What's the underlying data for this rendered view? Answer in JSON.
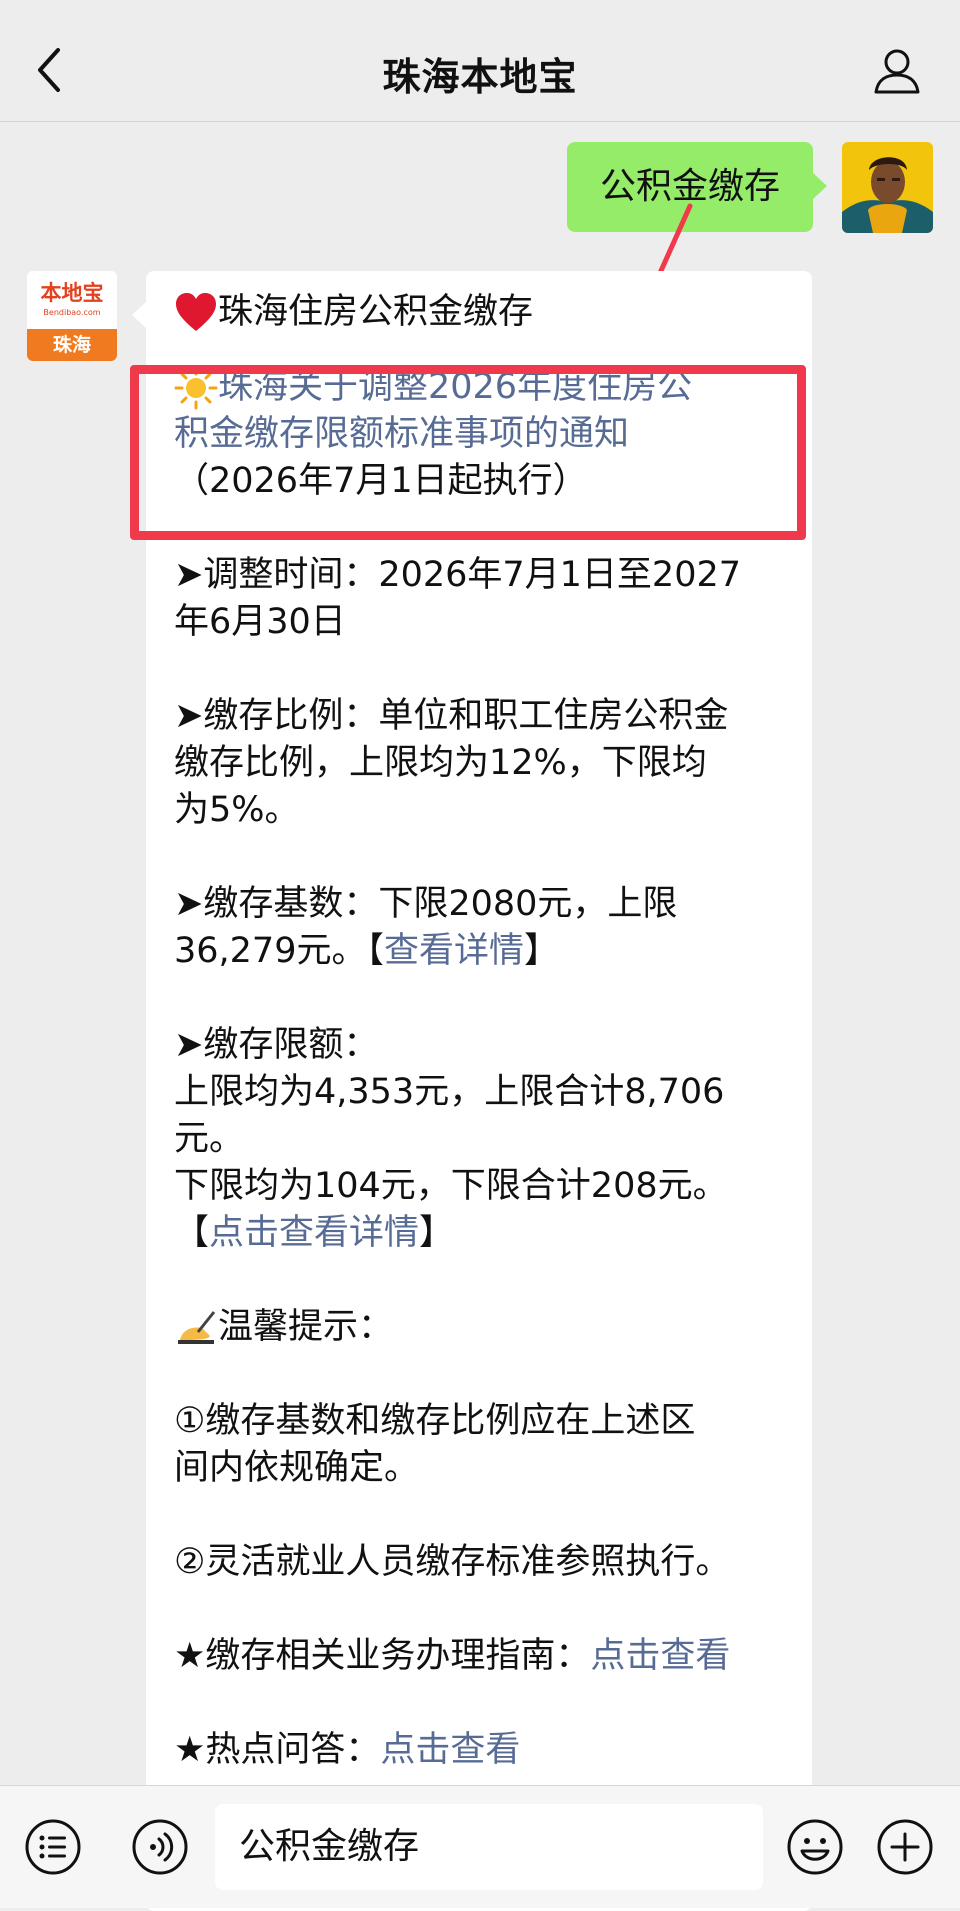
{
  "header": {
    "title": "珠海本地宝"
  },
  "outgoing": {
    "text": "公积金缴存"
  },
  "bot": {
    "avatar_text": "本地宝",
    "avatar_sub": "Bendibao.com",
    "avatar_city": "珠海"
  },
  "message": {
    "title": "珠海住房公积金缴存",
    "notice_line1": "珠海关于调整2026年度住房公",
    "notice_line2": "积金缴存限额标准事项的通知",
    "notice_line3": "（2026年7月1日起执行）",
    "time_line1": "➤调整时间：2026年7月1日至2027",
    "time_line2": "年6月30日",
    "ratio_line1": "➤缴存比例：单位和职工住房公积金",
    "ratio_line2": "缴存比例，上限均为12%，下限均",
    "ratio_line3": "为5%。",
    "base_line1": "➤缴存基数：下限2080元，上限",
    "base_line2_text": "36,279元。【",
    "base_link": "查看详情",
    "base_line2_end": "】",
    "limit_line1": "➤缴存限额：",
    "limit_line2": "上限均为4,353元，上限合计8,706",
    "limit_line3": "元。",
    "limit_line4": "下限均为104元，下限合计208元。",
    "limit_line5_open": "【",
    "limit_link": "点击查看详情",
    "limit_line5_close": "】",
    "tip_title": "温馨提示：",
    "tip1_line1": "①缴存基数和缴存比例应在上述区",
    "tip1_line2": "间内依规确定。",
    "tip2": "②灵活就业人员缴存标准参照执行。",
    "guide_text": "★缴存相关业务办理指南：",
    "guide_link": "点击查看",
    "faq_text": "★热点问答：",
    "faq_link": "点击查看"
  },
  "input_bar": {
    "value": "公积金缴存"
  },
  "colors": {
    "accent_green": "#95ec69",
    "link": "#576b95",
    "highlight_red": "#f0394a"
  }
}
